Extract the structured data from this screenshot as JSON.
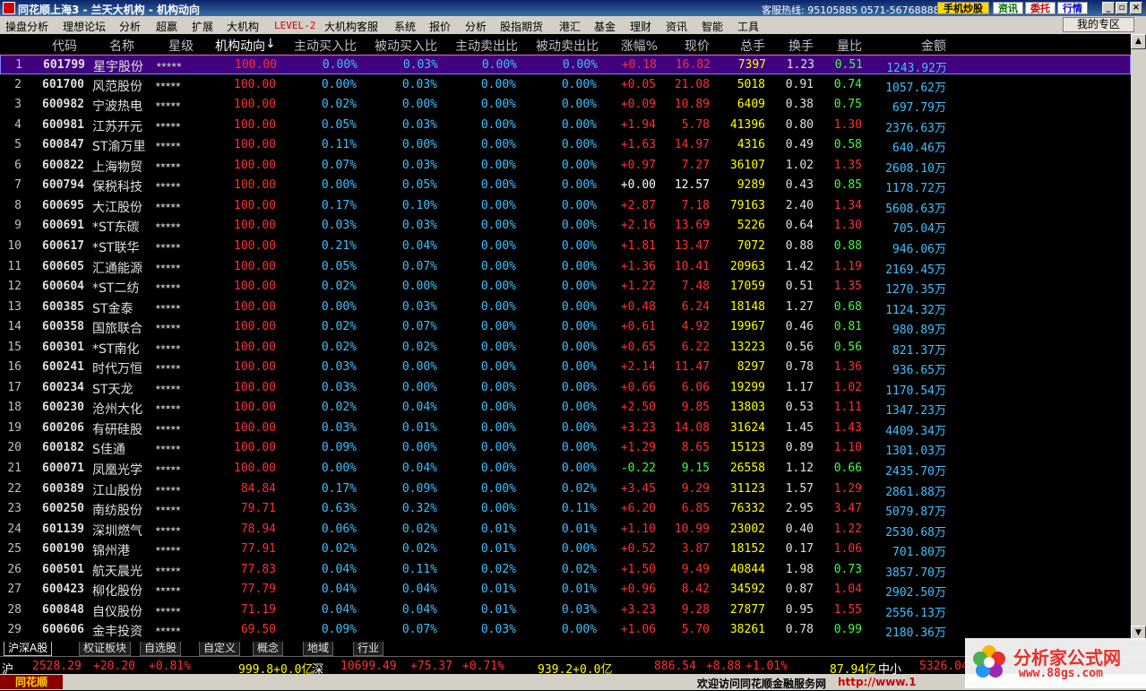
{
  "window": {
    "title": "同花顺上海3 - 兰天大机构 - 机构动向",
    "hotline": "客服热线: 95105885  0571-56768888",
    "btn_mobile": "手机炒股",
    "btn_info": "资讯",
    "btn_trust": "委托",
    "btn_quote": "行情",
    "logo_site": "www.55188.com"
  },
  "menu": {
    "items": [
      "操盘分析",
      "理想论坛",
      "分析",
      "超赢",
      "扩展",
      "大机构",
      "LEVEL-2",
      "大机构客服",
      "系统",
      "报价",
      "分析",
      "股指期货",
      "港汇",
      "基金",
      "理财",
      "资讯",
      "智能",
      "工具"
    ],
    "zone_button": "我的专区"
  },
  "table": {
    "headers": {
      "code": "代码",
      "name": "名称",
      "star": "星级",
      "jgdx": "机构动向",
      "sort_icon": "↓",
      "zmr": "主动买入比",
      "bmr": "被动买入比",
      "zmc": "主动卖出比",
      "bmc": "被动卖出比",
      "zf": "涨幅%",
      "xj": "现价",
      "zs": "总手",
      "hs": "换手",
      "lb": "量比",
      "je": "金额"
    },
    "rows": [
      {
        "idx": "1",
        "code": "601799",
        "name": "星宇股份",
        "star": "★★★★★",
        "jgdx": "100.00",
        "zmr": "0.00%",
        "bmr": "0.03%",
        "zmc": "0.00%",
        "bmc": "0.00%",
        "zf": "+0.18",
        "xj": "16.82",
        "zs": "7397",
        "hs": "1.23",
        "lb": "0.51",
        "je": "1243.92万",
        "dir": "up",
        "lbdir": "dn"
      },
      {
        "idx": "2",
        "code": "601700",
        "name": "风范股份",
        "star": "★★★★★",
        "jgdx": "100.00",
        "zmr": "0.00%",
        "bmr": "0.03%",
        "zmc": "0.00%",
        "bmc": "0.00%",
        "zf": "+0.05",
        "xj": "21.08",
        "zs": "5018",
        "hs": "0.91",
        "lb": "0.74",
        "je": "1057.62万",
        "dir": "up",
        "lbdir": "dn"
      },
      {
        "idx": "3",
        "code": "600982",
        "name": "宁波热电",
        "star": "★★★★★",
        "jgdx": "100.00",
        "zmr": "0.02%",
        "bmr": "0.00%",
        "zmc": "0.00%",
        "bmc": "0.00%",
        "zf": "+0.09",
        "xj": "10.89",
        "zs": "6409",
        "hs": "0.38",
        "lb": "0.75",
        "je": "697.79万",
        "dir": "up",
        "lbdir": "dn"
      },
      {
        "idx": "4",
        "code": "600981",
        "name": "江苏开元",
        "star": "★★★★★",
        "jgdx": "100.00",
        "zmr": "0.05%",
        "bmr": "0.03%",
        "zmc": "0.00%",
        "bmc": "0.00%",
        "zf": "+1.94",
        "xj": "5.78",
        "zs": "41396",
        "hs": "0.80",
        "lb": "1.30",
        "je": "2376.63万",
        "dir": "up",
        "lbdir": "up"
      },
      {
        "idx": "5",
        "code": "600847",
        "name": "ST渝万里",
        "star": "★★★★★",
        "jgdx": "100.00",
        "zmr": "0.11%",
        "bmr": "0.00%",
        "zmc": "0.00%",
        "bmc": "0.00%",
        "zf": "+1.63",
        "xj": "14.97",
        "zs": "4316",
        "hs": "0.49",
        "lb": "0.58",
        "je": "640.46万",
        "dir": "up",
        "lbdir": "dn"
      },
      {
        "idx": "6",
        "code": "600822",
        "name": "上海物贸",
        "star": "★★★★★",
        "jgdx": "100.00",
        "zmr": "0.07%",
        "bmr": "0.03%",
        "zmc": "0.00%",
        "bmc": "0.00%",
        "zf": "+0.97",
        "xj": "7.27",
        "zs": "36107",
        "hs": "1.02",
        "lb": "1.35",
        "je": "2608.10万",
        "dir": "up",
        "lbdir": "up"
      },
      {
        "idx": "7",
        "code": "600794",
        "name": "保税科技",
        "star": "★★★★★",
        "jgdx": "100.00",
        "zmr": "0.00%",
        "bmr": "0.05%",
        "zmc": "0.00%",
        "bmc": "0.00%",
        "zf": "+0.00",
        "xj": "12.57",
        "zs": "9289",
        "hs": "0.43",
        "lb": "0.85",
        "je": "1178.72万",
        "dir": "eq",
        "lbdir": "dn"
      },
      {
        "idx": "8",
        "code": "600695",
        "name": "大江股份",
        "star": "★★★★★",
        "jgdx": "100.00",
        "zmr": "0.17%",
        "bmr": "0.10%",
        "zmc": "0.00%",
        "bmc": "0.00%",
        "zf": "+2.87",
        "xj": "7.18",
        "zs": "79163",
        "hs": "2.40",
        "lb": "1.34",
        "je": "5608.63万",
        "dir": "up",
        "lbdir": "up"
      },
      {
        "idx": "9",
        "code": "600691",
        "name": "*ST东碳",
        "star": "★★★★★",
        "jgdx": "100.00",
        "zmr": "0.03%",
        "bmr": "0.03%",
        "zmc": "0.00%",
        "bmc": "0.00%",
        "zf": "+2.16",
        "xj": "13.69",
        "zs": "5226",
        "hs": "0.64",
        "lb": "1.30",
        "je": "705.04万",
        "dir": "up",
        "lbdir": "up"
      },
      {
        "idx": "10",
        "code": "600617",
        "name": "*ST联华",
        "star": "★★★★★",
        "jgdx": "100.00",
        "zmr": "0.21%",
        "bmr": "0.04%",
        "zmc": "0.00%",
        "bmc": "0.00%",
        "zf": "+1.81",
        "xj": "13.47",
        "zs": "7072",
        "hs": "0.88",
        "lb": "0.88",
        "je": "946.06万",
        "dir": "up",
        "lbdir": "dn"
      },
      {
        "idx": "11",
        "code": "600605",
        "name": "汇通能源",
        "star": "★★★★★",
        "jgdx": "100.00",
        "zmr": "0.05%",
        "bmr": "0.07%",
        "zmc": "0.00%",
        "bmc": "0.00%",
        "zf": "+1.36",
        "xj": "10.41",
        "zs": "20963",
        "hs": "1.42",
        "lb": "1.19",
        "je": "2169.45万",
        "dir": "up",
        "lbdir": "up"
      },
      {
        "idx": "12",
        "code": "600604",
        "name": "*ST二纺",
        "star": "★★★★★",
        "jgdx": "100.00",
        "zmr": "0.02%",
        "bmr": "0.00%",
        "zmc": "0.00%",
        "bmc": "0.00%",
        "zf": "+1.22",
        "xj": "7.48",
        "zs": "17059",
        "hs": "0.51",
        "lb": "1.35",
        "je": "1270.35万",
        "dir": "up",
        "lbdir": "up"
      },
      {
        "idx": "13",
        "code": "600385",
        "name": "ST金泰",
        "star": "★★★★★",
        "jgdx": "100.00",
        "zmr": "0.00%",
        "bmr": "0.03%",
        "zmc": "0.00%",
        "bmc": "0.00%",
        "zf": "+0.48",
        "xj": "6.24",
        "zs": "18148",
        "hs": "1.27",
        "lb": "0.68",
        "je": "1124.32万",
        "dir": "up",
        "lbdir": "dn"
      },
      {
        "idx": "14",
        "code": "600358",
        "name": "国旅联合",
        "star": "★★★★★",
        "jgdx": "100.00",
        "zmr": "0.02%",
        "bmr": "0.07%",
        "zmc": "0.00%",
        "bmc": "0.00%",
        "zf": "+0.61",
        "xj": "4.92",
        "zs": "19967",
        "hs": "0.46",
        "lb": "0.81",
        "je": "980.89万",
        "dir": "up",
        "lbdir": "dn"
      },
      {
        "idx": "15",
        "code": "600301",
        "name": "*ST南化",
        "star": "★★★★★",
        "jgdx": "100.00",
        "zmr": "0.02%",
        "bmr": "0.02%",
        "zmc": "0.00%",
        "bmc": "0.00%",
        "zf": "+0.65",
        "xj": "6.22",
        "zs": "13223",
        "hs": "0.56",
        "lb": "0.56",
        "je": "821.37万",
        "dir": "up",
        "lbdir": "dn"
      },
      {
        "idx": "16",
        "code": "600241",
        "name": "时代万恒",
        "star": "★★★★★",
        "jgdx": "100.00",
        "zmr": "0.03%",
        "bmr": "0.00%",
        "zmc": "0.00%",
        "bmc": "0.00%",
        "zf": "+2.14",
        "xj": "11.47",
        "zs": "8297",
        "hs": "0.78",
        "lb": "1.36",
        "je": "936.65万",
        "dir": "up",
        "lbdir": "up"
      },
      {
        "idx": "17",
        "code": "600234",
        "name": "ST天龙",
        "star": "★★★★★",
        "jgdx": "100.00",
        "zmr": "0.03%",
        "bmr": "0.00%",
        "zmc": "0.00%",
        "bmc": "0.00%",
        "zf": "+0.66",
        "xj": "6.06",
        "zs": "19299",
        "hs": "1.17",
        "lb": "1.02",
        "je": "1170.54万",
        "dir": "up",
        "lbdir": "up"
      },
      {
        "idx": "18",
        "code": "600230",
        "name": "沧州大化",
        "star": "★★★★★",
        "jgdx": "100.00",
        "zmr": "0.02%",
        "bmr": "0.04%",
        "zmc": "0.00%",
        "bmc": "0.00%",
        "zf": "+2.50",
        "xj": "9.85",
        "zs": "13803",
        "hs": "0.53",
        "lb": "1.11",
        "je": "1347.23万",
        "dir": "up",
        "lbdir": "up"
      },
      {
        "idx": "19",
        "code": "600206",
        "name": "有研硅股",
        "star": "★★★★★",
        "jgdx": "100.00",
        "zmr": "0.03%",
        "bmr": "0.01%",
        "zmc": "0.00%",
        "bmc": "0.00%",
        "zf": "+3.23",
        "xj": "14.08",
        "zs": "31624",
        "hs": "1.45",
        "lb": "1.43",
        "je": "4409.34万",
        "dir": "up",
        "lbdir": "up"
      },
      {
        "idx": "20",
        "code": "600182",
        "name": "S佳通",
        "star": "★★★★★",
        "jgdx": "100.00",
        "zmr": "0.09%",
        "bmr": "0.00%",
        "zmc": "0.00%",
        "bmc": "0.00%",
        "zf": "+1.29",
        "xj": "8.65",
        "zs": "15123",
        "hs": "0.89",
        "lb": "1.10",
        "je": "1301.03万",
        "dir": "up",
        "lbdir": "up"
      },
      {
        "idx": "21",
        "code": "600071",
        "name": "凤凰光学",
        "star": "★★★★★",
        "jgdx": "100.00",
        "zmr": "0.00%",
        "bmr": "0.04%",
        "zmc": "0.00%",
        "bmc": "0.00%",
        "zf": "-0.22",
        "xj": "9.15",
        "zs": "26558",
        "hs": "1.12",
        "lb": "0.66",
        "je": "2435.70万",
        "dir": "dn",
        "lbdir": "dn"
      },
      {
        "idx": "22",
        "code": "600389",
        "name": "江山股份",
        "star": "★★★★★",
        "jgdx": "84.84",
        "zmr": "0.17%",
        "bmr": "0.09%",
        "zmc": "0.00%",
        "bmc": "0.02%",
        "zf": "+3.45",
        "xj": "9.29",
        "zs": "31123",
        "hs": "1.57",
        "lb": "1.29",
        "je": "2861.88万",
        "dir": "up",
        "lbdir": "up"
      },
      {
        "idx": "23",
        "code": "600250",
        "name": "南纺股份",
        "star": "★★★★★",
        "jgdx": "79.71",
        "zmr": "0.63%",
        "bmr": "0.32%",
        "zmc": "0.00%",
        "bmc": "0.11%",
        "zf": "+6.20",
        "xj": "6.85",
        "zs": "76332",
        "hs": "2.95",
        "lb": "3.47",
        "je": "5079.87万",
        "dir": "up",
        "lbdir": "up"
      },
      {
        "idx": "24",
        "code": "601139",
        "name": "深圳燃气",
        "star": "★★★★★",
        "jgdx": "78.94",
        "zmr": "0.06%",
        "bmr": "0.02%",
        "zmc": "0.01%",
        "bmc": "0.01%",
        "zf": "+1.10",
        "xj": "10.99",
        "zs": "23002",
        "hs": "0.40",
        "lb": "1.22",
        "je": "2530.68万",
        "dir": "up",
        "lbdir": "up"
      },
      {
        "idx": "25",
        "code": "600190",
        "name": "锦州港",
        "star": "★★★★★",
        "jgdx": "77.91",
        "zmr": "0.02%",
        "bmr": "0.02%",
        "zmc": "0.01%",
        "bmc": "0.00%",
        "zf": "+0.52",
        "xj": "3.87",
        "zs": "18152",
        "hs": "0.17",
        "lb": "1.06",
        "je": "701.80万",
        "dir": "up",
        "lbdir": "up"
      },
      {
        "idx": "26",
        "code": "600501",
        "name": "航天晨光",
        "star": "★★★★★",
        "jgdx": "77.83",
        "zmr": "0.04%",
        "bmr": "0.11%",
        "zmc": "0.02%",
        "bmc": "0.02%",
        "zf": "+1.50",
        "xj": "9.49",
        "zs": "40844",
        "hs": "1.98",
        "lb": "0.73",
        "je": "3857.70万",
        "dir": "up",
        "lbdir": "dn"
      },
      {
        "idx": "27",
        "code": "600423",
        "name": "柳化股份",
        "star": "★★★★★",
        "jgdx": "77.79",
        "zmr": "0.04%",
        "bmr": "0.04%",
        "zmc": "0.01%",
        "bmc": "0.01%",
        "zf": "+0.96",
        "xj": "8.42",
        "zs": "34592",
        "hs": "0.87",
        "lb": "1.04",
        "je": "2902.50万",
        "dir": "up",
        "lbdir": "up"
      },
      {
        "idx": "28",
        "code": "600848",
        "name": "自仪股份",
        "star": "★★★★★",
        "jgdx": "71.19",
        "zmr": "0.04%",
        "bmr": "0.04%",
        "zmc": "0.01%",
        "bmc": "0.03%",
        "zf": "+3.23",
        "xj": "9.28",
        "zs": "27877",
        "hs": "0.95",
        "lb": "1.55",
        "je": "2556.13万",
        "dir": "up",
        "lbdir": "up"
      },
      {
        "idx": "29",
        "code": "600606",
        "name": "金丰投资",
        "star": "★★★★★",
        "jgdx": "69.50",
        "zmr": "0.09%",
        "bmr": "0.07%",
        "zmc": "0.03%",
        "bmc": "0.00%",
        "zf": "+1.06",
        "xj": "5.70",
        "zs": "38261",
        "hs": "0.78",
        "lb": "0.99",
        "je": "2180.36万",
        "dir": "up",
        "lbdir": "dn"
      }
    ]
  },
  "tabs": [
    "沪深A股",
    "权证板块",
    "自选股",
    "自定义",
    "概念",
    "地域",
    "行业"
  ],
  "index_bar": {
    "sh_label": "沪",
    "sh_value": "2528.29",
    "sh_change": "+20.20",
    "sh_pct": "+0.81%",
    "sh_amount": "999.8+0.0亿",
    "sz_label": "深",
    "sz_value": "10699.49",
    "sz_change": "+75.37",
    "sz_pct": "+0.71%",
    "sz_amount": "939.2+0.0亿",
    "x_value": "886.54",
    "x_change": "+8.88",
    "x_pct": "+1.01%",
    "x_amount": "87.94亿",
    "zx_label": "中小",
    "zx_value": "5326.04"
  },
  "status": {
    "brand": "同花顺",
    "welcome": "欢迎访问同花顺金融服务网",
    "url": "http://www.1"
  },
  "watermark": {
    "text": "分析家公式网",
    "url": "www.88gs.com"
  },
  "colors": {
    "up": "#ff3030",
    "down": "#40ff40",
    "selected_row": "#400080"
  }
}
